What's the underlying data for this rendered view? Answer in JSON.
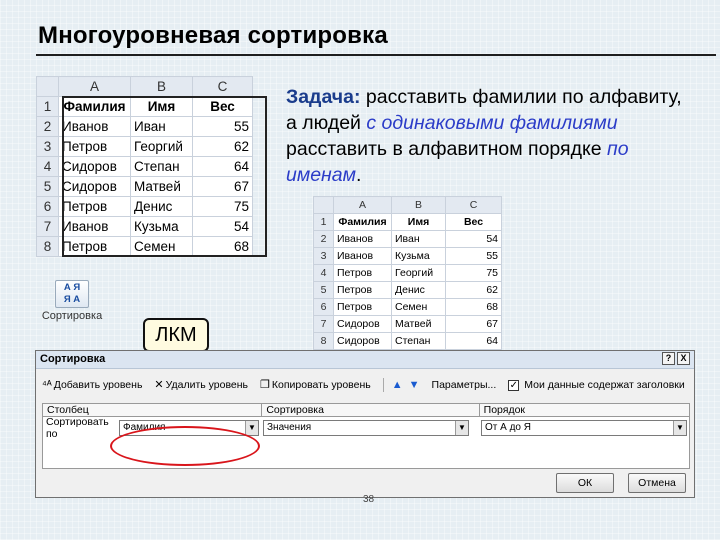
{
  "slide": {
    "title": "Многоуровневая сортировка"
  },
  "task": {
    "label": "Задача:",
    "part1": " расставить фамилии по алфавиту, а людей ",
    "em1": "с одинаковыми фамилиями",
    "part2": " расставить в алфавитном порядке ",
    "em2": "по именам",
    "part3": "."
  },
  "sheet1": {
    "columns": [
      "A",
      "B",
      "C"
    ],
    "row_numbers": [
      "1",
      "2",
      "3",
      "4",
      "5",
      "6",
      "7",
      "8"
    ],
    "header": [
      "Фамилия",
      "Имя",
      "Вес"
    ],
    "rows": [
      [
        "Иванов",
        "Иван",
        "55"
      ],
      [
        "Петров",
        "Георгий",
        "62"
      ],
      [
        "Сидоров",
        "Степан",
        "64"
      ],
      [
        "Сидоров",
        "Матвей",
        "67"
      ],
      [
        "Петров",
        "Денис",
        "75"
      ],
      [
        "Иванов",
        "Кузьма",
        "54"
      ],
      [
        "Петров",
        "Семен",
        "68"
      ]
    ]
  },
  "sheet2": {
    "columns": [
      "A",
      "B",
      "C"
    ],
    "row_numbers": [
      "1",
      "2",
      "3",
      "4",
      "5",
      "6",
      "7",
      "8"
    ],
    "header": [
      "Фамилия",
      "Имя",
      "Вес"
    ],
    "rows": [
      [
        "Иванов",
        "Иван",
        "54"
      ],
      [
        "Иванов",
        "Кузьма",
        "55"
      ],
      [
        "Петров",
        "Георгий",
        "75"
      ],
      [
        "Петров",
        "Денис",
        "62"
      ],
      [
        "Петров",
        "Семен",
        "68"
      ],
      [
        "Сидоров",
        "Матвей",
        "67"
      ],
      [
        "Сидоров",
        "Степан",
        "64"
      ]
    ]
  },
  "ribbon": {
    "sort_button_label": "Сортировка",
    "sort_icon_text": "А Я\nЯ А"
  },
  "callout": {
    "text": "ЛКМ"
  },
  "dialog": {
    "title": "Сортировка",
    "help": "?",
    "close": "X",
    "toolbar": {
      "add_level": "Добавить уровень",
      "delete_level": "Удалить уровень",
      "copy_level": "Копировать уровень",
      "options": "Параметры...",
      "has_headers": "Мои данные содержат заголовки"
    },
    "columns": {
      "column": "Столбец",
      "sort_on": "Сортировка",
      "order": "Порядок"
    },
    "row": {
      "label": "Сортировать по",
      "column_value": "Фамилия",
      "sort_on_value": "Значения",
      "order_value": "От А до Я"
    },
    "ok": "ОК",
    "cancel": "Отмена"
  },
  "page_number": "38",
  "colors": {
    "accent": "#1a3c8c",
    "emphasis": "#2b3cc8",
    "highlight": "#d9151b"
  }
}
